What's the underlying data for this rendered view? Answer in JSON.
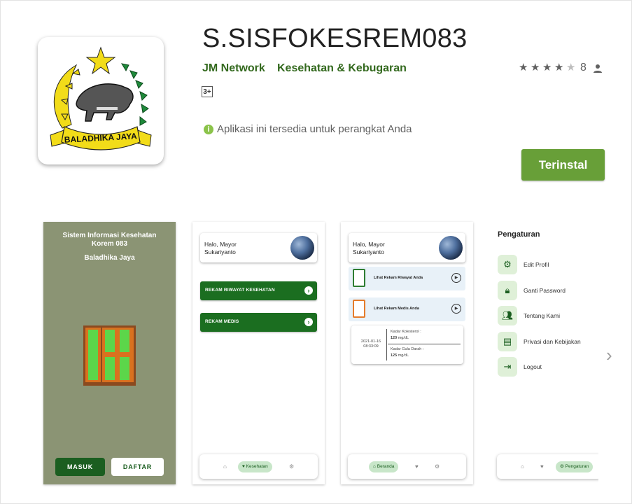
{
  "app": {
    "title": "S.SISFOKESREM083",
    "developer": "JM Network",
    "category": "Kesehatan & Kebugaran",
    "content_rating": "3+",
    "rating_value": 4.5,
    "rating_count": "8",
    "availability": "Aplikasi ini tersedia untuk perangkat Anda",
    "install_label": "Terinstal",
    "icon_banner_text": "BALADHIKA JAYA",
    "accent_color": "#689f38",
    "link_color": "#33691e"
  },
  "shot1": {
    "title_line1": "Sistem Informasi Kesehatan",
    "title_line2": "Korem 083",
    "subtitle": "Baladhika Jaya",
    "masuk": "MASUK",
    "daftar": "DAFTAR"
  },
  "shot2": {
    "greet_line1": "Halo,  Mayor",
    "greet_line2": "Sukariyanto",
    "btn1": "REKAM RIWAYAT KESEHATAN",
    "btn2": "REKAM MEDIS",
    "nav_active": "Kesehatan"
  },
  "shot3": {
    "greet_line1": "Halo,  Mayor",
    "greet_line2": "Sukariyanto",
    "row1": "Lihat Rekam Riwayat Anda",
    "row2": "Lihat Rekam Medis Anda",
    "date": "2021-01-16",
    "time": "08:33:09",
    "kol_label": "Kadar Kolesterol :",
    "kol_value": "120",
    "kol_unit": "mg/dL",
    "gula_label": "Kadar Gula Darah :",
    "gula_value": "125",
    "gula_unit": "mg/dL",
    "nav_active": "Beranda"
  },
  "shot4": {
    "title": "Pengaturan",
    "items": [
      "Edit Profil",
      "Ganti Password",
      "Tentang Kami",
      "Privasi dan Kebijakan",
      "Logout"
    ],
    "nav_active": "Pengaturan"
  }
}
